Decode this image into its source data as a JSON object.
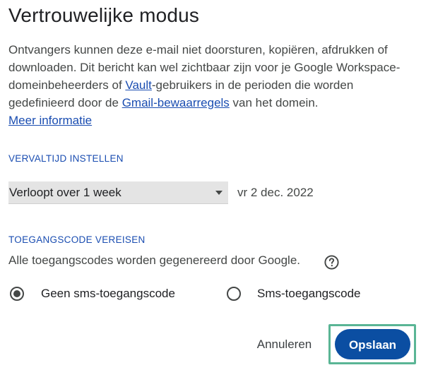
{
  "dialog": {
    "title": "Vertrouwelijke modus",
    "description": {
      "part1": "Ontvangers kunnen deze e-mail niet doorsturen, kopiëren, afdrukken of downloaden. Dit bericht kan wel zichtbaar zijn voor je Google Workspace-domeinbeheerders of ",
      "link_vault": "Vault",
      "part2": "-gebruikers in de perioden die worden gedefinieerd door de ",
      "link_retention": "Gmail-bewaarregels",
      "part3": " van het domein."
    },
    "more_info_link": "Meer informatie"
  },
  "expiry": {
    "section_label": "VERVALTIJD INSTELLEN",
    "selected_option": "Verloopt over 1 week",
    "expiry_date": "vr 2 dec. 2022"
  },
  "passcode": {
    "section_label": "TOEGANGSCODE VEREISEN",
    "info_text": "Alle toegangscodes worden gegenereerd door Google.",
    "options": [
      {
        "label": "Geen sms-toegangscode",
        "selected": true
      },
      {
        "label": "Sms-toegangscode",
        "selected": false
      }
    ]
  },
  "actions": {
    "cancel_label": "Annuleren",
    "save_label": "Opslaan"
  },
  "colors": {
    "link": "#1a4db1",
    "primary_button": "#0b4ea2",
    "highlight_border": "#5ab595",
    "select_background": "#e4e4e4"
  },
  "icons": {
    "help": "help-circle-icon",
    "dropdown": "dropdown-arrow-icon",
    "radio_selected": "radio-checked-icon",
    "radio_unselected": "radio-unchecked-icon"
  }
}
